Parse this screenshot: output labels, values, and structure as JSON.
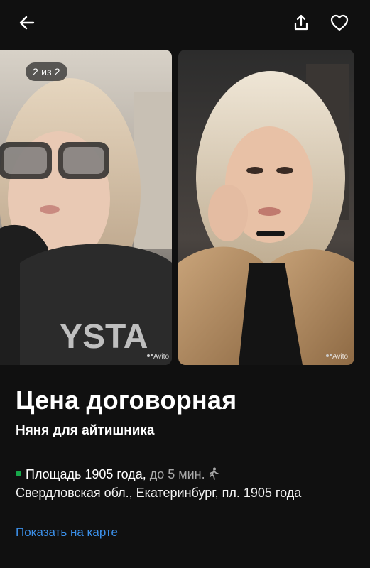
{
  "header": {
    "back_icon": "arrow-left-icon",
    "share_icon": "share-icon",
    "favorite_icon": "heart-icon"
  },
  "gallery": {
    "counter": "2 из 2",
    "watermark": "Avito",
    "photos": [
      "photo-1",
      "photo-2"
    ]
  },
  "listing": {
    "price": "Цена договорная",
    "title": "Няня для айтишника",
    "metro": {
      "name": "Площадь 1905 года,",
      "distance": "до 5 мин.",
      "color": "#17a84a"
    },
    "address": "Свердловская обл., Екатеринбург, пл. 1905 года",
    "map_link": "Показать на карте"
  },
  "colors": {
    "background": "#101010",
    "link": "#3b8fe8"
  }
}
